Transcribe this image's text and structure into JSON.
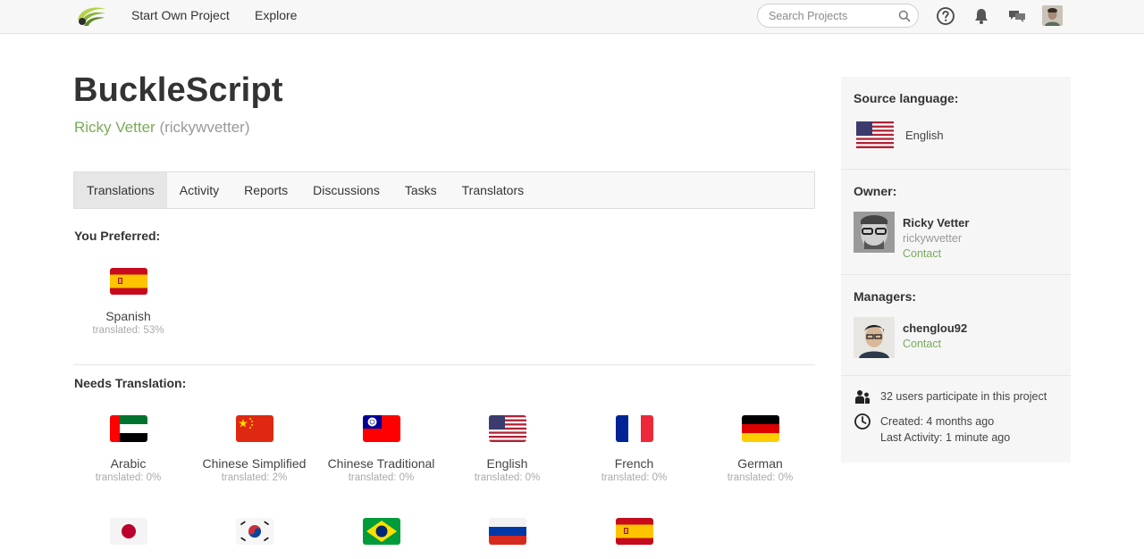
{
  "nav": {
    "start_own_project": "Start Own Project",
    "explore": "Explore",
    "search_placeholder": "Search Projects"
  },
  "project": {
    "title": "BuckleScript",
    "owner_name": "Ricky Vetter",
    "owner_handle": "(rickywvetter)"
  },
  "tabs": [
    {
      "label": "Translations",
      "active": true
    },
    {
      "label": "Activity"
    },
    {
      "label": "Reports"
    },
    {
      "label": "Discussions"
    },
    {
      "label": "Tasks"
    },
    {
      "label": "Translators"
    }
  ],
  "preferred": {
    "heading": "You Preferred:",
    "languages": [
      {
        "name": "Spanish",
        "progress": "translated: 53%",
        "flag": "spain-flag"
      }
    ]
  },
  "needs_translation": {
    "heading": "Needs Translation:",
    "languages": [
      {
        "name": "Arabic",
        "progress": "translated: 0%",
        "flag": "uae-flag"
      },
      {
        "name": "Chinese Simplified",
        "progress": "translated: 2%",
        "flag": "china-flag"
      },
      {
        "name": "Chinese Traditional",
        "progress": "translated: 0%",
        "flag": "taiwan-flag"
      },
      {
        "name": "English",
        "progress": "translated: 0%",
        "flag": "usa-flag"
      },
      {
        "name": "French",
        "progress": "translated: 0%",
        "flag": "france-flag"
      },
      {
        "name": "German",
        "progress": "translated: 0%",
        "flag": "germany-flag"
      }
    ],
    "more_flags": [
      "japan-flag",
      "south-korea-flag",
      "brazil-flag",
      "russia-flag",
      "spain-flag"
    ]
  },
  "sidebar": {
    "source_language": {
      "title": "Source language:",
      "language": "English"
    },
    "owner": {
      "title": "Owner:",
      "name": "Ricky Vetter",
      "handle": "rickywvetter",
      "contact": "Contact"
    },
    "managers": {
      "title": "Managers:",
      "name": "chenglou92",
      "contact": "Contact"
    },
    "meta": {
      "participants": "32 users participate in this project",
      "created": "Created: 4 months ago",
      "last_activity": "Last Activity: 1 minute ago"
    }
  },
  "colors": {
    "accent_green": "#7aab5a",
    "muted_text": "#999999",
    "sidebar_bg": "#f6f6f6"
  }
}
